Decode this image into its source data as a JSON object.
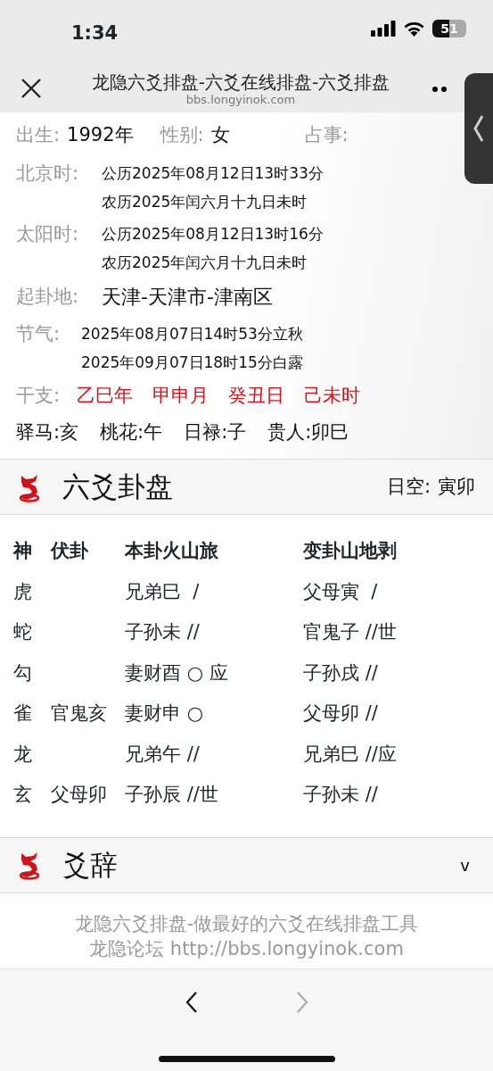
{
  "status_bar": {
    "time": "1:34",
    "battery": "51"
  },
  "browser": {
    "title": "龙隐六爻排盘-六爻在线排盘-六爻排盘",
    "url": "bbs.longyinok.com"
  },
  "info": {
    "birth_label": "出生:",
    "birth": "1992年",
    "gender_label": "性别:",
    "gender": "女",
    "matter_label": "占事:",
    "rows": [
      {
        "label": "北京时:",
        "lines": [
          "公历2025年08月12日13时33分",
          "农历2025年闰六月十九日未时"
        ],
        "kind": "small"
      },
      {
        "label": "太阳时:",
        "lines": [
          "公历2025年08月12日13时16分",
          "农历2025年闰六月十九日未时"
        ],
        "kind": "small"
      },
      {
        "label": "起卦地:",
        "lines": [
          "天津-天津市-津南区"
        ],
        "kind": "large"
      },
      {
        "label": "节气:",
        "lines": [
          "2025年08月07日14时53分立秋",
          "2025年09月07日18时15分白露"
        ],
        "kind": "small"
      }
    ],
    "ganzhi_label": "干支:",
    "ganzhi": [
      "乙巳年",
      "甲申月",
      "癸丑日",
      "己未时"
    ],
    "stars": [
      "驿马:亥",
      "桃花:午",
      "日禄:子",
      "贵人:卯巳"
    ]
  },
  "chart_section": {
    "title": "六爻卦盘",
    "kong_label": "日空:",
    "kong": "寅卯",
    "columns": [
      "神",
      "伏卦",
      "本卦火山旅",
      "变卦山地剥"
    ],
    "rows": [
      [
        "虎",
        "",
        "兄弟巳  /",
        "父母寅  /"
      ],
      [
        "蛇",
        "",
        "子孙未 //",
        "官鬼子 //世"
      ],
      [
        "勾",
        "",
        "妻财酉 ○ 应",
        "子孙戌 //"
      ],
      [
        "雀",
        "官鬼亥",
        "妻财申 ○",
        "父母卯 //"
      ],
      [
        "龙",
        "",
        "兄弟午 //",
        "兄弟巳 //应"
      ],
      [
        "玄",
        "父母卯",
        "子孙辰 //世",
        "子孙未 //"
      ]
    ]
  },
  "yaoci_section": {
    "title": "爻辞",
    "toggle": "v",
    "expanded": false
  },
  "footer": [
    "龙隐六爻排盘-做最好的六爻在线排盘工具",
    "龙隐论坛 http://bbs.longyinok.com"
  ],
  "toolbar": {
    "back": {
      "disabled": false
    },
    "forward": {
      "disabled": true
    }
  }
}
